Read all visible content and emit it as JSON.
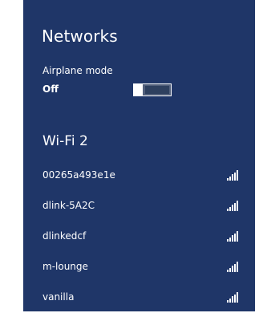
{
  "panel": {
    "title": "Networks",
    "background_color": "#1f3668"
  },
  "airplane_mode": {
    "label": "Airplane mode",
    "state": "Off",
    "enabled": false
  },
  "wifi_section": {
    "title": "Wi-Fi 2"
  },
  "networks": [
    {
      "name": "00265a493e1e",
      "signal_icon": "wifi-signal-icon",
      "signal_bars": 5
    },
    {
      "name": "dlink-5A2C",
      "signal_icon": "wifi-signal-icon",
      "signal_bars": 5
    },
    {
      "name": "dlinkedcf",
      "signal_icon": "wifi-signal-icon",
      "signal_bars": 5
    },
    {
      "name": "m-lounge",
      "signal_icon": "wifi-signal-icon",
      "signal_bars": 5
    },
    {
      "name": "vanilla",
      "signal_icon": "wifi-signal-icon",
      "signal_bars": 5
    }
  ]
}
